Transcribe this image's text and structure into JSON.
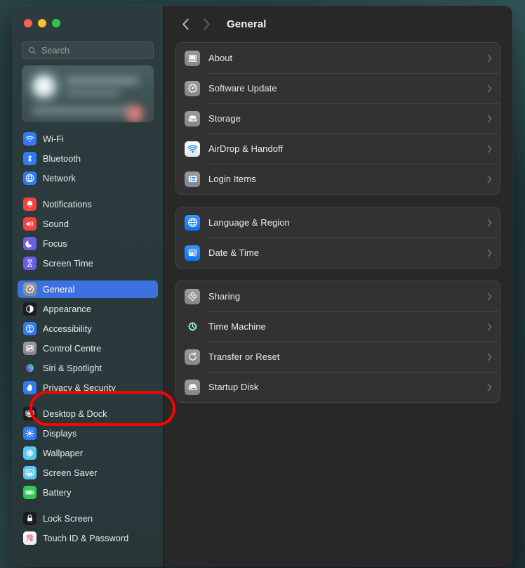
{
  "window": {
    "traffic_lights": [
      {
        "name": "close",
        "color": "#fd5f57"
      },
      {
        "name": "minimize",
        "color": "#febc2e"
      },
      {
        "name": "zoom",
        "color": "#28c840"
      }
    ]
  },
  "search": {
    "placeholder": "Search",
    "value": ""
  },
  "account": {
    "redacted": true
  },
  "sidebar": {
    "groups": [
      {
        "items": [
          {
            "label": "Wi-Fi",
            "icon": "wifi-icon",
            "color": "#2f7cf6",
            "selected": false
          },
          {
            "label": "Bluetooth",
            "icon": "bluetooth-icon",
            "color": "#2f7cf6",
            "selected": false
          },
          {
            "label": "Network",
            "icon": "network-globe-icon",
            "color": "#2f7cf6",
            "selected": false
          }
        ]
      },
      {
        "items": [
          {
            "label": "Notifications",
            "icon": "notifications-bell-icon",
            "color": "#f6433f",
            "selected": false
          },
          {
            "label": "Sound",
            "icon": "sound-speaker-icon",
            "color": "#f6433f",
            "selected": false
          },
          {
            "label": "Focus",
            "icon": "focus-moon-icon",
            "color": "#6c5ce7",
            "selected": false
          },
          {
            "label": "Screen Time",
            "icon": "screen-time-hourglass-icon",
            "color": "#6c5ce7",
            "selected": false
          }
        ]
      },
      {
        "items": [
          {
            "label": "General",
            "icon": "general-gear-icon",
            "color": "#8a8a8e",
            "selected": true
          },
          {
            "label": "Appearance",
            "icon": "appearance-contrast-icon",
            "color": "#1c1c1e",
            "selected": false
          },
          {
            "label": "Accessibility",
            "icon": "accessibility-person-icon",
            "color": "#2f7cf6",
            "selected": false
          },
          {
            "label": "Control Centre",
            "icon": "control-centre-sliders-icon",
            "color": "#8a8a8e",
            "selected": false
          },
          {
            "label": "Siri & Spotlight",
            "icon": "siri-orb-icon",
            "color": "#c04a8c",
            "selected": false
          },
          {
            "label": "Privacy & Security",
            "icon": "privacy-hand-icon",
            "color": "#2f7cf6",
            "selected": false
          }
        ]
      },
      {
        "items": [
          {
            "label": "Desktop & Dock",
            "icon": "desktop-dock-icon",
            "color": "#1c1c1e",
            "selected": false
          },
          {
            "label": "Displays",
            "icon": "displays-brightness-icon",
            "color": "#2f7cf6",
            "selected": false
          },
          {
            "label": "Wallpaper",
            "icon": "wallpaper-flower-icon",
            "color": "#5ac8f5",
            "selected": false
          },
          {
            "label": "Screen Saver",
            "icon": "screen-saver-icon",
            "color": "#5ac8f5",
            "selected": false
          },
          {
            "label": "Battery",
            "icon": "battery-icon",
            "color": "#32c759",
            "selected": false
          }
        ]
      },
      {
        "items": [
          {
            "label": "Lock Screen",
            "icon": "lock-screen-icon",
            "color": "#1c1c1e",
            "selected": false
          },
          {
            "label": "Touch ID & Password",
            "icon": "touch-id-icon",
            "color": "#f8f8f8",
            "selected": false
          }
        ]
      }
    ]
  },
  "toolbar": {
    "back_label": "Back",
    "forward_label": "Forward",
    "title": "General",
    "back_enabled": true,
    "forward_enabled": false
  },
  "main": {
    "groups": [
      {
        "rows": [
          {
            "label": "About",
            "icon": "about-laptop-icon",
            "style": "gray"
          },
          {
            "label": "Software Update",
            "icon": "software-update-gear-icon",
            "style": "gray"
          },
          {
            "label": "Storage",
            "icon": "storage-drive-icon",
            "style": "gray"
          },
          {
            "label": "AirDrop & Handoff",
            "icon": "airdrop-icon",
            "style": "white-blue"
          },
          {
            "label": "Login Items",
            "icon": "login-items-list-icon",
            "style": "gray"
          }
        ]
      },
      {
        "rows": [
          {
            "label": "Language & Region",
            "icon": "language-globe-icon",
            "style": "blue"
          },
          {
            "label": "Date & Time",
            "icon": "date-time-calendar-icon",
            "style": "blue"
          }
        ]
      },
      {
        "rows": [
          {
            "label": "Sharing",
            "icon": "sharing-icon",
            "style": "gray"
          },
          {
            "label": "Time Machine",
            "icon": "time-machine-icon",
            "style": "green"
          },
          {
            "label": "Transfer or Reset",
            "icon": "transfer-reset-icon",
            "style": "gray"
          },
          {
            "label": "Startup Disk",
            "icon": "startup-disk-icon",
            "style": "gray"
          }
        ]
      }
    ],
    "disclosure_icon": "chevron-right-icon"
  },
  "annotation": {
    "shape": "rounded-rectangle",
    "color": "#ff0000",
    "targets": "Privacy & Security"
  }
}
